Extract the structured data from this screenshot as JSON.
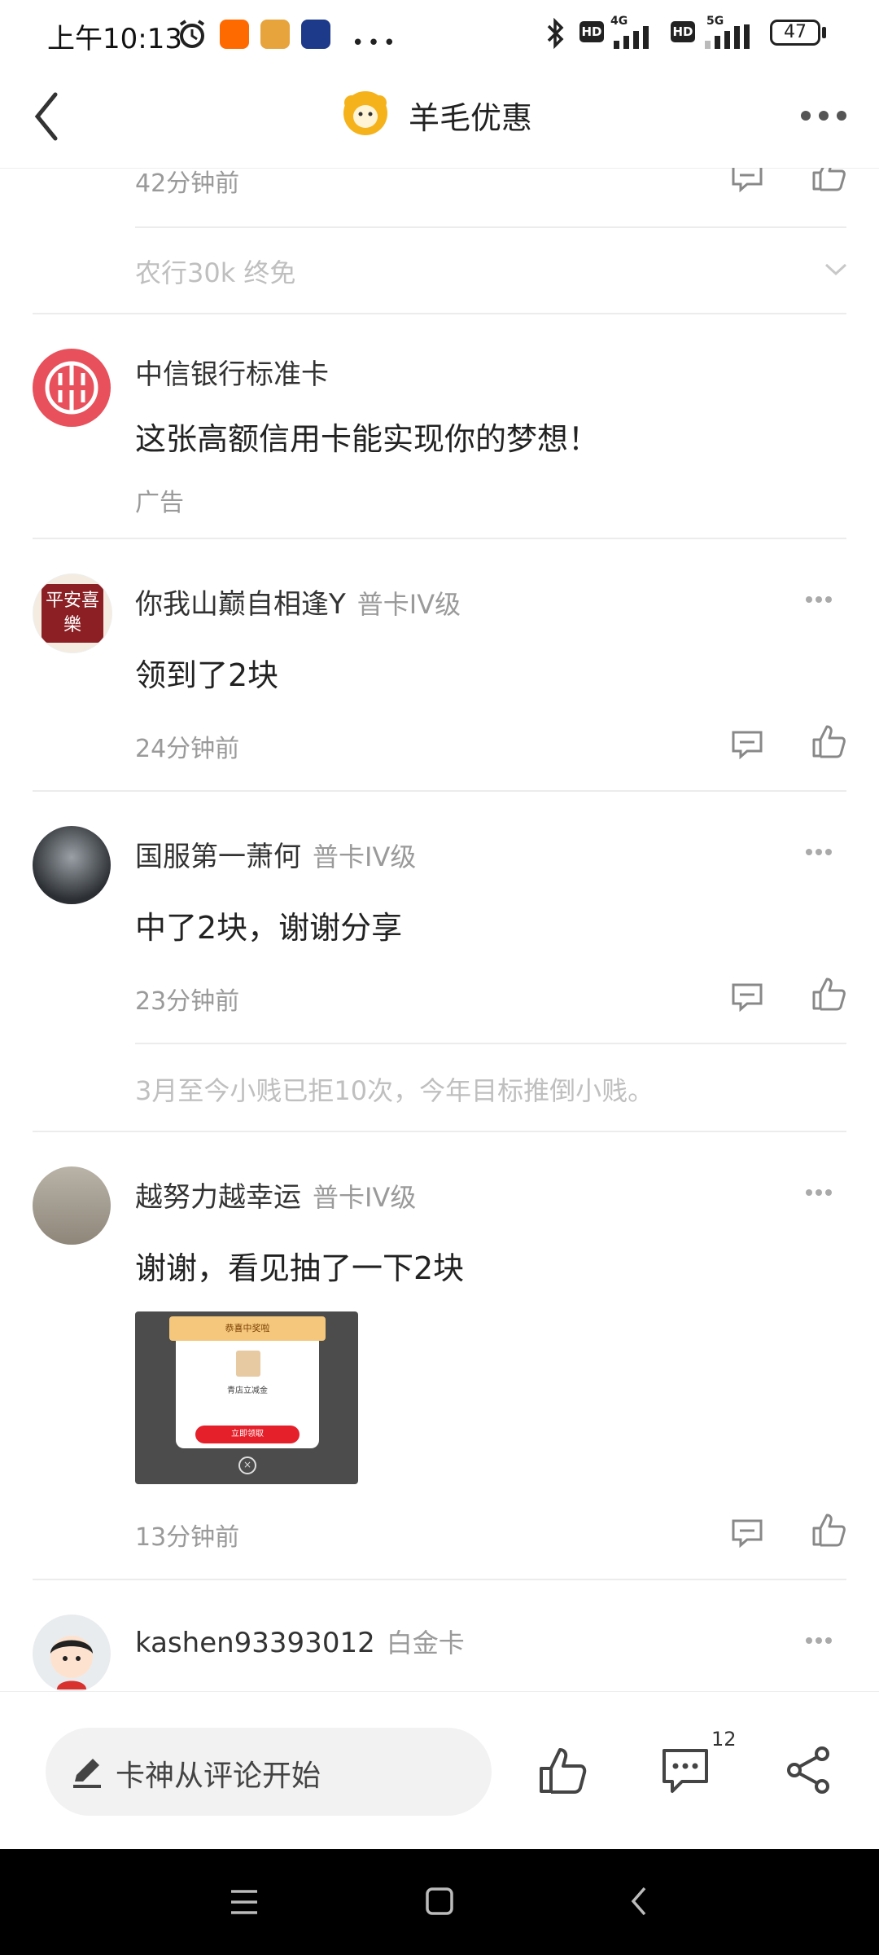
{
  "status_bar": {
    "time": "上午10:13",
    "battery": "47",
    "network1": "4G",
    "network2": "5G",
    "hd": "HD"
  },
  "header": {
    "title": "羊毛优惠"
  },
  "feed": {
    "prev_time": "42分钟前",
    "prev_reply": "农行30k 终免",
    "ad": {
      "name": "中信银行标准卡",
      "text": "这张高额信用卡能实现你的梦想！",
      "label": "广告"
    },
    "comments": [
      {
        "name": "你我山巅自相逢Y",
        "badge": "普卡IV级",
        "content": "领到了2块",
        "time": "24分钟前",
        "avatar_text": "平安喜樂"
      },
      {
        "name": "国服第一萧何",
        "badge": "普卡IV级",
        "content": "中了2块，谢谢分享",
        "time": "23分钟前",
        "reply": "3月至今小贱已拒10次，今年目标推倒小贱。"
      },
      {
        "name": "越努力越幸运",
        "badge": "普卡IV级",
        "content": "谢谢，看见抽了一下2块",
        "time": "13分钟前",
        "image_popup_title": "恭喜中奖啦",
        "image_popup_text": "青店立减金",
        "image_popup_button": "立即领取"
      },
      {
        "name": "kashen93393012",
        "badge": "白金卡"
      }
    ]
  },
  "bottom_bar": {
    "comment_placeholder": "卡神从评论开始",
    "comment_count": "12"
  },
  "colors": {
    "citic_red": "#e8505b",
    "popup_red": "#e5202a",
    "text_grey": "#9a9a9a"
  }
}
